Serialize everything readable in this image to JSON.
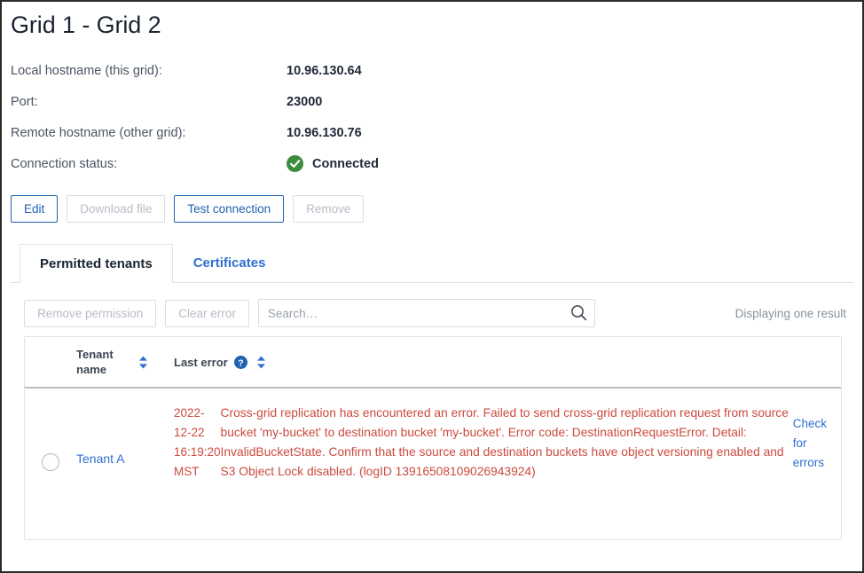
{
  "page": {
    "title": "Grid 1 - Grid 2"
  },
  "details": [
    {
      "label": "Local hostname (this grid):",
      "value": "10.96.130.64"
    },
    {
      "label": "Port:",
      "value": "23000"
    },
    {
      "label": "Remote hostname (other grid):",
      "value": "10.96.130.76"
    },
    {
      "label": "Connection status:",
      "value": "Connected",
      "icon": "check-circle-icon",
      "icon_color": "#3c8b3c"
    }
  ],
  "buttons": [
    {
      "label": "Edit",
      "state": "enabled"
    },
    {
      "label": "Download file",
      "state": "disabled"
    },
    {
      "label": "Test connection",
      "state": "enabled"
    },
    {
      "label": "Remove",
      "state": "disabled"
    }
  ],
  "tabs": [
    {
      "label": "Permitted tenants",
      "active": true
    },
    {
      "label": "Certificates",
      "active": false
    }
  ],
  "toolbar": {
    "remove_permission_label": "Remove permission",
    "clear_error_label": "Clear error",
    "search_placeholder": "Search…",
    "search_value": "",
    "search_icon": "magnifier-icon",
    "result_count": "Displaying one result"
  },
  "table": {
    "columns": [
      {
        "key": "select",
        "label": ""
      },
      {
        "key": "tenant_name",
        "label_line1": "Tenant",
        "label_line2": "name",
        "sortable": true
      },
      {
        "key": "last_error",
        "label": "Last error",
        "sortable": true,
        "help": "help-icon"
      }
    ],
    "rows": [
      {
        "selected": false,
        "tenant_name": "Tenant A",
        "error_time": "2022-12-22 16:19:20 MST",
        "error_message": "Cross-grid replication has encountered an error. Failed to send cross-grid replication request from source bucket 'my-bucket' to destination bucket 'my-bucket'. Error code: DestinationRequestError. Detail: InvalidBucketState. Confirm that the source and destination buckets have object versioning enabled and S3 Object Lock disabled. (logID 13916508109026943924)",
        "error_link": "Check for errors"
      }
    ]
  },
  "colors": {
    "accent_blue": "#2f6fd0",
    "button_blue": "#1f62b0",
    "error_red": "#cb4a3f",
    "success_green": "#3c8b3c",
    "border_gray": "#dfe3e8"
  }
}
